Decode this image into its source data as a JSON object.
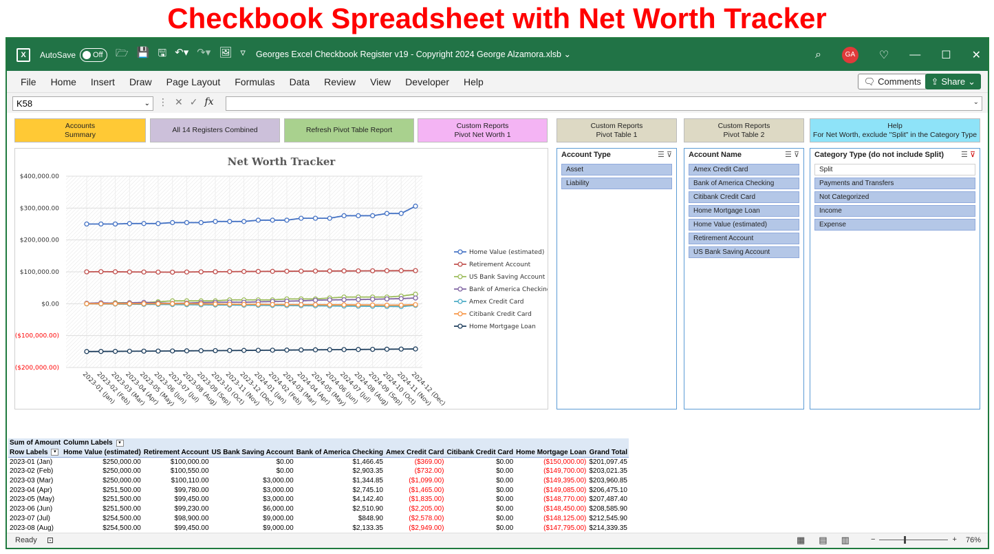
{
  "banner": "Checkbook Spreadsheet with Net Worth Tracker",
  "titlebar": {
    "app_icon": "excel-icon",
    "autosave_label": "AutoSave",
    "autosave_state": "Off",
    "doc_title": "Georges Excel Checkbook Register v19 - Copyright 2024 George Alzamora.xlsb",
    "avatar": "GA"
  },
  "ribbon": {
    "tabs": [
      "File",
      "Home",
      "Insert",
      "Draw",
      "Page Layout",
      "Formulas",
      "Data",
      "Review",
      "View",
      "Developer",
      "Help"
    ],
    "comments": "Comments",
    "share": "Share"
  },
  "formula_bar": {
    "name_box": "K58",
    "fx": "fx",
    "formula": ""
  },
  "buttons": {
    "accounts_summary": [
      "Accounts",
      "Summary"
    ],
    "registers_combined": "All 14 Registers Combined",
    "refresh_pivot": "Refresh Pivot Table Report",
    "pivot_net_worth": [
      "Custom Reports",
      "Pivot Net Worth 1"
    ],
    "pivot_table_1": [
      "Custom Reports",
      "Pivot Table 1"
    ],
    "pivot_table_2": [
      "Custom Reports",
      "Pivot Table 2"
    ],
    "help": [
      "Help",
      "For Net Worth, exclude \"Split\" in the Category Type"
    ],
    "colors": {
      "accounts_summary": "#ffc935",
      "registers_combined": "#ccc0da",
      "refresh_pivot": "#a9d18e",
      "pivot_net_worth": "#f4b4f4",
      "pivot_table": "#ddd9c4",
      "help": "#8ee3f8"
    }
  },
  "slicers": {
    "account_type": {
      "title": "Account Type",
      "items": [
        "Asset",
        "Liability"
      ]
    },
    "account_name": {
      "title": "Account Name",
      "items": [
        "Amex Credit Card",
        "Bank of America Checking",
        "Citibank Credit Card",
        "Home Mortgage Loan",
        "Home Value (estimated)",
        "Retirement Account",
        "US Bank Saving Account"
      ]
    },
    "category_type": {
      "title": "Category Type (do not include Split)",
      "items": [
        "Split",
        "Payments and Transfers",
        "Not Categorized",
        "Income",
        "Expense"
      ],
      "unselected": [
        "Split"
      ]
    }
  },
  "chart_data": {
    "type": "line",
    "title": "Net Worth Tracker",
    "ylim": [
      -200000,
      400000
    ],
    "y_ticks": [
      "$400,000.00",
      "$300,000.00",
      "$200,000.00",
      "$100,000.00",
      "$0.00",
      "($100,000.00)",
      "($200,000.00)"
    ],
    "y_tick_values": [
      400000,
      300000,
      200000,
      100000,
      0,
      -100000,
      -200000
    ],
    "grid": true,
    "legend_position": "right",
    "categories": [
      "2023-01 (Jan)",
      "2023-02 (Feb)",
      "2023-03 (Mar)",
      "2023-04 (Apr)",
      "2023-05 (May)",
      "2023-06 (Jun)",
      "2023-07 (Jul)",
      "2023-08 (Aug)",
      "2023-09 (Sep)",
      "2023-10 (Oct)",
      "2023-11 (Nov)",
      "2023-12 (Dec)",
      "2024-01 (Jan)",
      "2024-02 (Feb)",
      "2024-03 (Mar)",
      "2024-04 (Apr)",
      "2024-05 (May)",
      "2024-06 (Jun)",
      "2024-07 (Jul)",
      "2024-08 (Aug)",
      "2024-09 (Sep)",
      "2024-10 (Oct)",
      "2024-11 (Nov)",
      "2024-12 (Dec)"
    ],
    "series": [
      {
        "name": "Home Value (estimated)",
        "color": "#4472c4",
        "values": [
          250000,
          250000,
          250000,
          251500,
          251500,
          251500,
          254500,
          254500,
          254500,
          258000,
          258000,
          258000,
          262000,
          262000,
          262000,
          268000,
          268000,
          268000,
          276000,
          276000,
          276000,
          283000,
          283000,
          306000
        ]
      },
      {
        "name": "Retirement Account",
        "color": "#c0504d",
        "values": [
          100000,
          100550,
          100110,
          99780,
          99450,
          99230,
          98900,
          99450,
          100000,
          100300,
          100600,
          100900,
          101200,
          101500,
          101800,
          102100,
          102400,
          102600,
          102800,
          103000,
          103200,
          103400,
          103600,
          103800
        ]
      },
      {
        "name": "US Bank Saving Account",
        "color": "#9bbb59",
        "values": [
          0,
          0,
          3000,
          3000,
          3000,
          6000,
          9000,
          9000,
          9000,
          9000,
          12000,
          12000,
          12000,
          12000,
          15000,
          15000,
          15000,
          18000,
          21000,
          21000,
          21000,
          21000,
          24000,
          30000
        ]
      },
      {
        "name": "Bank of America Checking",
        "color": "#8064a2",
        "values": [
          1466.45,
          2903.35,
          1344.85,
          2745.1,
          4142.4,
          2510.9,
          848.9,
          2133.35,
          3500,
          4200,
          5000,
          4500,
          6000,
          7000,
          8000,
          9000,
          11000,
          12000,
          12500,
          13000,
          14000,
          15000,
          16000,
          18000
        ]
      },
      {
        "name": "Amex Credit Card",
        "color": "#4bacc6",
        "values": [
          -369,
          -732,
          -1099,
          -1465,
          -1835,
          -2205,
          -2578,
          -2949,
          -3300,
          -3700,
          -4100,
          -4500,
          -4900,
          -5300,
          -5700,
          -6100,
          -6500,
          -6900,
          -7300,
          -7700,
          -8100,
          -8500,
          -8900,
          -5000
        ]
      },
      {
        "name": "Citibank Credit Card",
        "color": "#f79646",
        "values": [
          0,
          0,
          0,
          0,
          0,
          0,
          0,
          0,
          -500,
          -1000,
          -1500,
          -2000,
          -2000,
          -2500,
          -2500,
          -3000,
          -3000,
          -3500,
          -3500,
          -4000,
          -4000,
          -4500,
          -4500,
          -3000
        ]
      },
      {
        "name": "Home Mortgage Loan",
        "color": "#1f3f5e",
        "values": [
          -150000,
          -149700,
          -149395,
          -149085,
          -148770,
          -148450,
          -148125,
          -147795,
          -147460,
          -147120,
          -146775,
          -146425,
          -146070,
          -145710,
          -145345,
          -144975,
          -144600,
          -144220,
          -143835,
          -143445,
          -143050,
          -142650,
          -142245,
          -141835
        ]
      }
    ]
  },
  "pivot": {
    "corner_label": "Sum of Amount",
    "column_labels": "Column Labels",
    "row_labels": "Row Labels",
    "headers": [
      "Home Value (estimated)",
      "Retirement Account",
      "US Bank Saving Account",
      "Bank of America Checking",
      "Amex Credit Card",
      "Citibank Credit Card",
      "Home Mortgage Loan",
      "Grand Total"
    ],
    "rows": [
      [
        "2023-01 (Jan)",
        "$250,000.00",
        "$100,000.00",
        "$0.00",
        "$1,466.45",
        "($369.00)",
        "$0.00",
        "($150,000.00)",
        "$201,097.45"
      ],
      [
        "2023-02 (Feb)",
        "$250,000.00",
        "$100,550.00",
        "$0.00",
        "$2,903.35",
        "($732.00)",
        "$0.00",
        "($149,700.00)",
        "$203,021.35"
      ],
      [
        "2023-03 (Mar)",
        "$250,000.00",
        "$100,110.00",
        "$3,000.00",
        "$1,344.85",
        "($1,099.00)",
        "$0.00",
        "($149,395.00)",
        "$203,960.85"
      ],
      [
        "2023-04 (Apr)",
        "$251,500.00",
        "$99,780.00",
        "$3,000.00",
        "$2,745.10",
        "($1,465.00)",
        "$0.00",
        "($149,085.00)",
        "$206,475.10"
      ],
      [
        "2023-05 (May)",
        "$251,500.00",
        "$99,450.00",
        "$3,000.00",
        "$4,142.40",
        "($1,835.00)",
        "$0.00",
        "($148,770.00)",
        "$207,487.40"
      ],
      [
        "2023-06 (Jun)",
        "$251,500.00",
        "$99,230.00",
        "$6,000.00",
        "$2,510.90",
        "($2,205.00)",
        "$0.00",
        "($148,450.00)",
        "$208,585.90"
      ],
      [
        "2023-07 (Jul)",
        "$254,500.00",
        "$98,900.00",
        "$9,000.00",
        "$848.90",
        "($2,578.00)",
        "$0.00",
        "($148,125.00)",
        "$212,545.90"
      ],
      [
        "2023-08 (Aug)",
        "$254,500.00",
        "$99,450.00",
        "$9,000.00",
        "$2,133.35",
        "($2,949.00)",
        "$0.00",
        "($147,795.00)",
        "$214,339.35"
      ]
    ]
  },
  "statusbar": {
    "ready": "Ready",
    "zoom": "76%",
    "zoom_fraction": 0.36
  }
}
